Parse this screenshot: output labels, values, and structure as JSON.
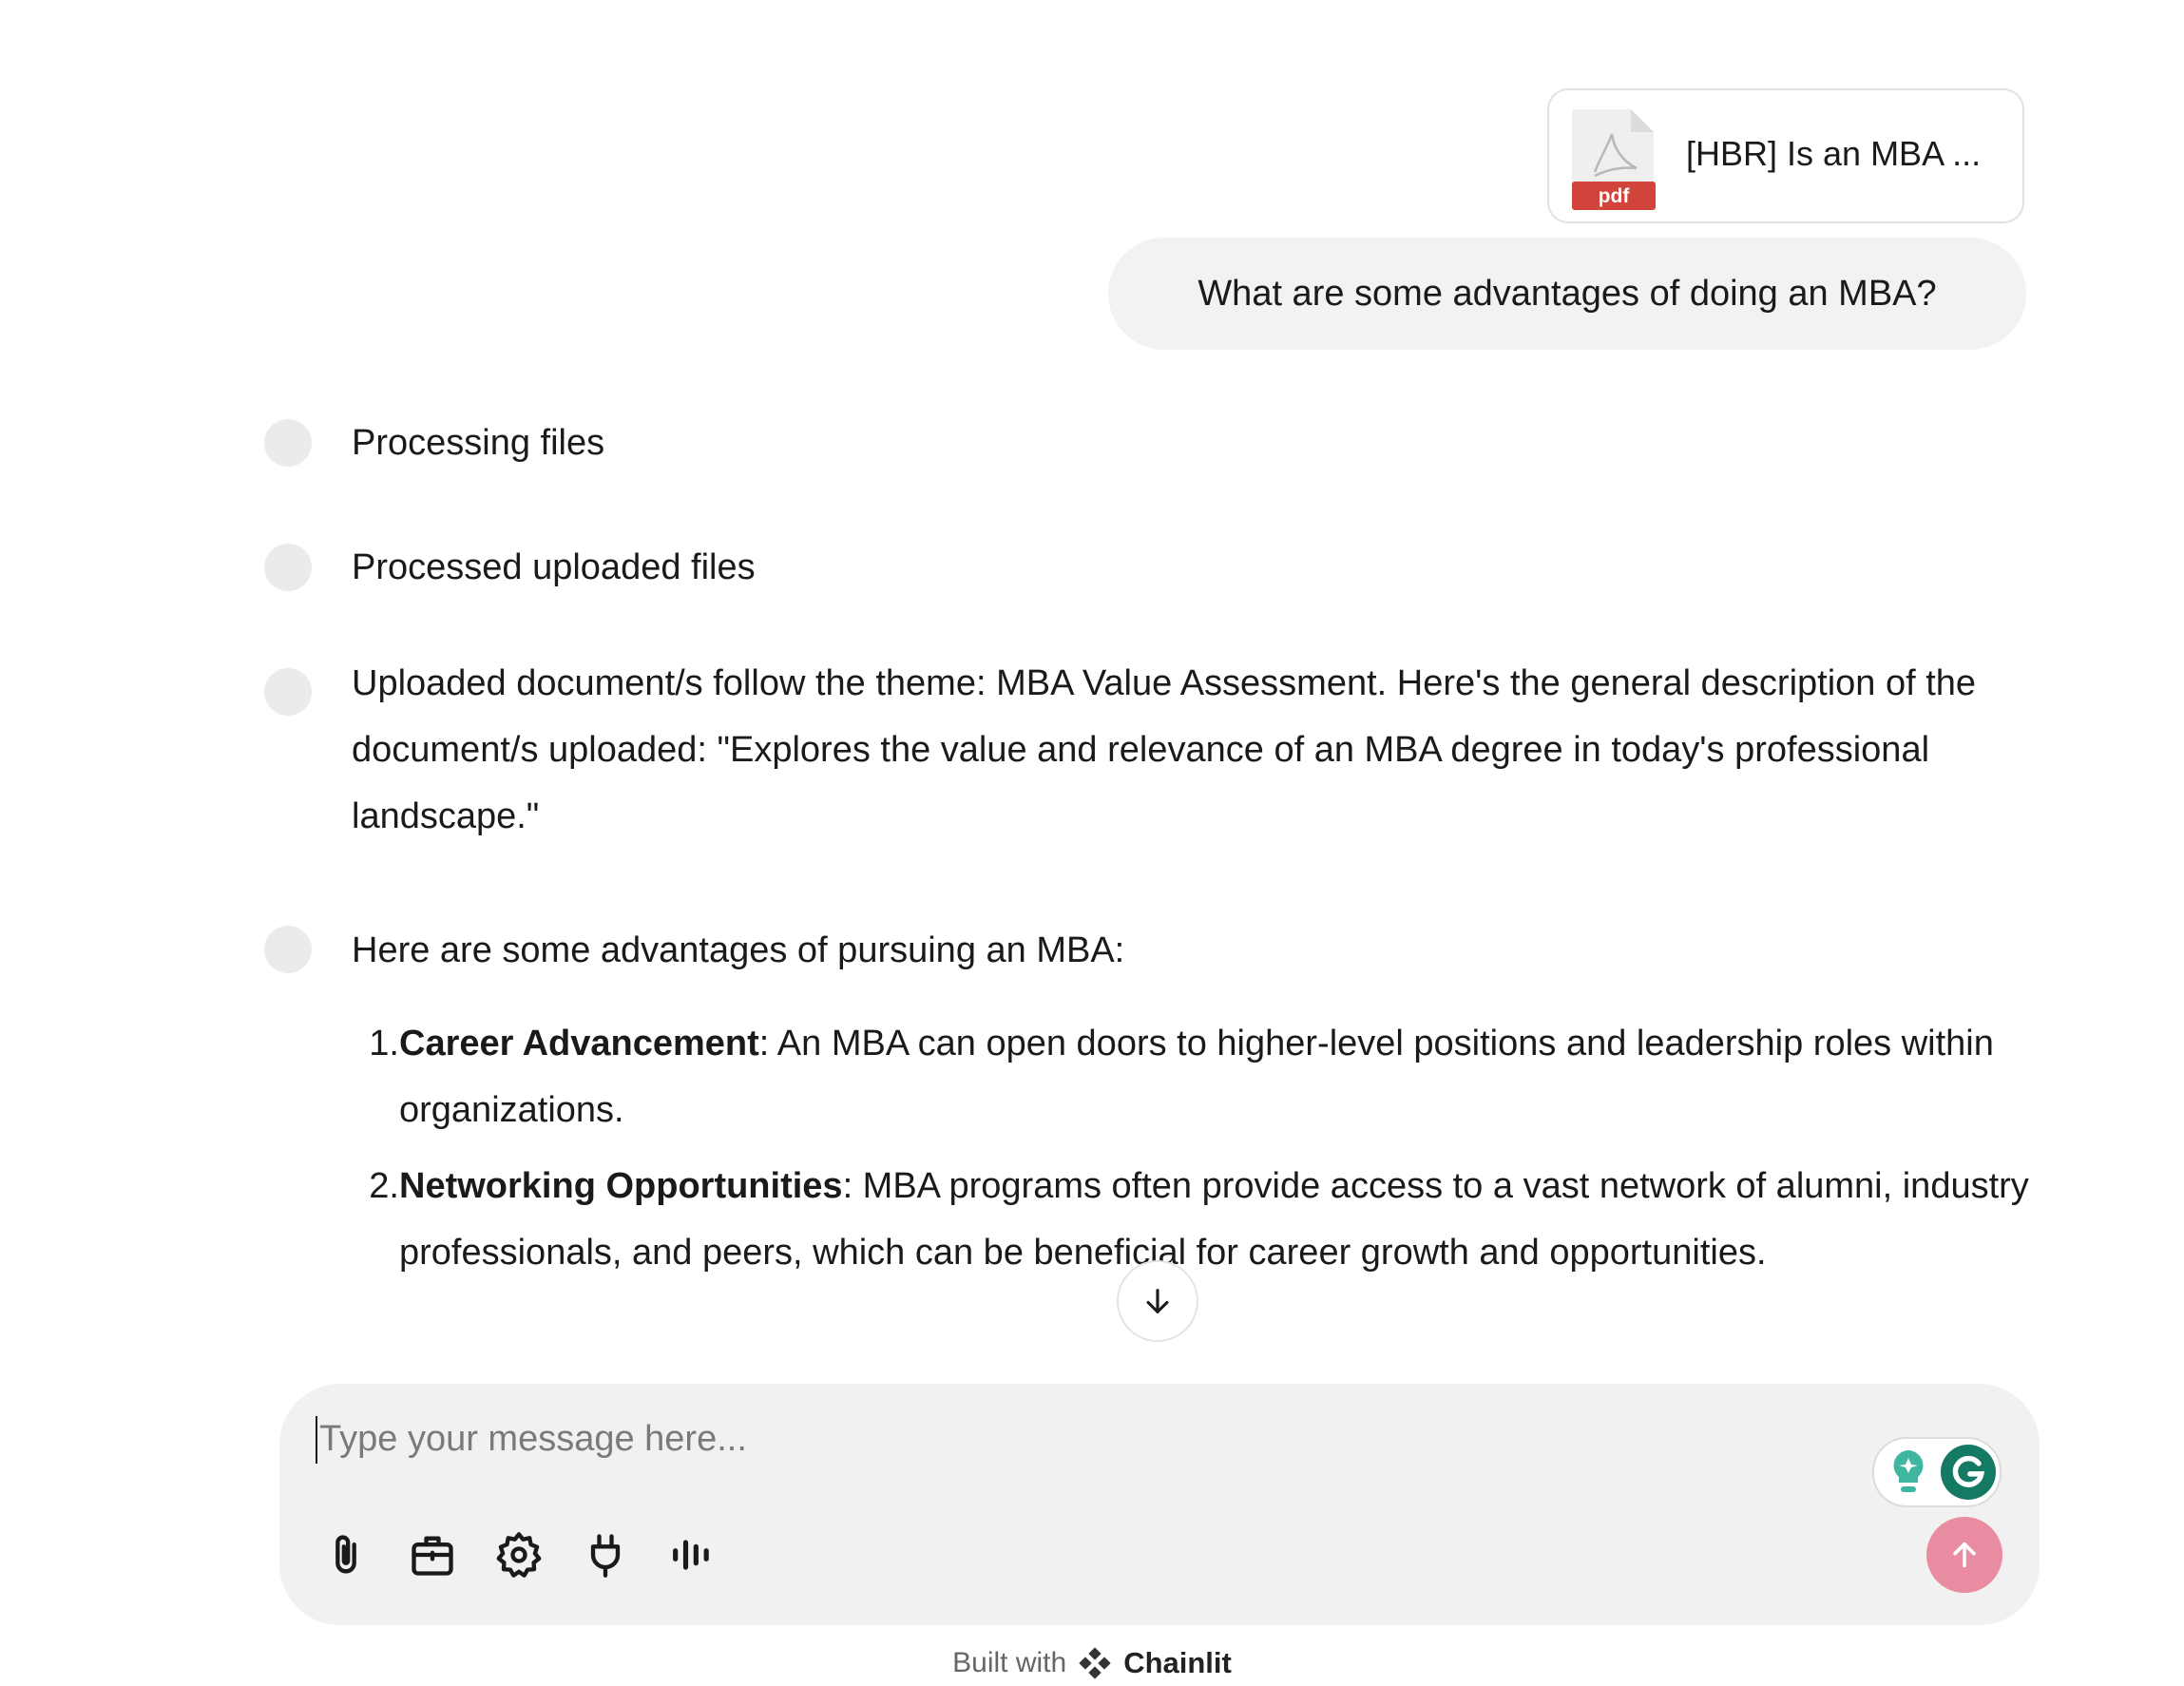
{
  "attachment": {
    "file_name": "[HBR] Is an MBA ...",
    "file_type_label": "pdf",
    "icon": "pdf-file-icon"
  },
  "user_message": "What are some advantages of doing an MBA?",
  "steps": [
    {
      "text": "Processing files"
    },
    {
      "text": "Processed uploaded files"
    }
  ],
  "theme_message": "Uploaded document/s follow the theme: MBA Value Assessment. Here's the general description of the document/s uploaded: \"Explores the value and relevance of an MBA degree in today's professional landscape.\"",
  "answer": {
    "intro": "Here are some advantages of pursuing an MBA:",
    "items": [
      {
        "num": "1.",
        "title": "Career Advancement",
        "text": ": An MBA can open doors to higher-level positions and leadership roles within organizations."
      },
      {
        "num": "2.",
        "title": "Networking Opportunities",
        "text": ": MBA programs often provide access to a vast network of alumni, industry professionals, and peers, which can be beneficial for career growth and opportunities."
      }
    ]
  },
  "composer": {
    "placeholder": "Type your message here...",
    "tools": [
      "attach-icon",
      "briefcase-icon",
      "settings-gear-icon",
      "plug-icon",
      "voice-wave-icon"
    ],
    "send_color": "#e98ba1"
  },
  "footer": {
    "built_with": "Built with",
    "brand": "Chainlit"
  }
}
